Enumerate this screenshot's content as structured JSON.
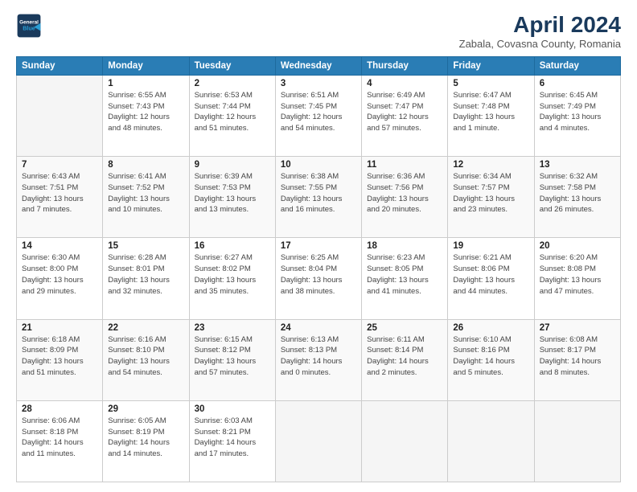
{
  "header": {
    "logo_line1": "General",
    "logo_line2": "Blue",
    "title": "April 2024",
    "subtitle": "Zabala, Covasna County, Romania"
  },
  "weekdays": [
    "Sunday",
    "Monday",
    "Tuesday",
    "Wednesday",
    "Thursday",
    "Friday",
    "Saturday"
  ],
  "weeks": [
    [
      {
        "num": "",
        "info": ""
      },
      {
        "num": "1",
        "info": "Sunrise: 6:55 AM\nSunset: 7:43 PM\nDaylight: 12 hours\nand 48 minutes."
      },
      {
        "num": "2",
        "info": "Sunrise: 6:53 AM\nSunset: 7:44 PM\nDaylight: 12 hours\nand 51 minutes."
      },
      {
        "num": "3",
        "info": "Sunrise: 6:51 AM\nSunset: 7:45 PM\nDaylight: 12 hours\nand 54 minutes."
      },
      {
        "num": "4",
        "info": "Sunrise: 6:49 AM\nSunset: 7:47 PM\nDaylight: 12 hours\nand 57 minutes."
      },
      {
        "num": "5",
        "info": "Sunrise: 6:47 AM\nSunset: 7:48 PM\nDaylight: 13 hours\nand 1 minute."
      },
      {
        "num": "6",
        "info": "Sunrise: 6:45 AM\nSunset: 7:49 PM\nDaylight: 13 hours\nand 4 minutes."
      }
    ],
    [
      {
        "num": "7",
        "info": "Sunrise: 6:43 AM\nSunset: 7:51 PM\nDaylight: 13 hours\nand 7 minutes."
      },
      {
        "num": "8",
        "info": "Sunrise: 6:41 AM\nSunset: 7:52 PM\nDaylight: 13 hours\nand 10 minutes."
      },
      {
        "num": "9",
        "info": "Sunrise: 6:39 AM\nSunset: 7:53 PM\nDaylight: 13 hours\nand 13 minutes."
      },
      {
        "num": "10",
        "info": "Sunrise: 6:38 AM\nSunset: 7:55 PM\nDaylight: 13 hours\nand 16 minutes."
      },
      {
        "num": "11",
        "info": "Sunrise: 6:36 AM\nSunset: 7:56 PM\nDaylight: 13 hours\nand 20 minutes."
      },
      {
        "num": "12",
        "info": "Sunrise: 6:34 AM\nSunset: 7:57 PM\nDaylight: 13 hours\nand 23 minutes."
      },
      {
        "num": "13",
        "info": "Sunrise: 6:32 AM\nSunset: 7:58 PM\nDaylight: 13 hours\nand 26 minutes."
      }
    ],
    [
      {
        "num": "14",
        "info": "Sunrise: 6:30 AM\nSunset: 8:00 PM\nDaylight: 13 hours\nand 29 minutes."
      },
      {
        "num": "15",
        "info": "Sunrise: 6:28 AM\nSunset: 8:01 PM\nDaylight: 13 hours\nand 32 minutes."
      },
      {
        "num": "16",
        "info": "Sunrise: 6:27 AM\nSunset: 8:02 PM\nDaylight: 13 hours\nand 35 minutes."
      },
      {
        "num": "17",
        "info": "Sunrise: 6:25 AM\nSunset: 8:04 PM\nDaylight: 13 hours\nand 38 minutes."
      },
      {
        "num": "18",
        "info": "Sunrise: 6:23 AM\nSunset: 8:05 PM\nDaylight: 13 hours\nand 41 minutes."
      },
      {
        "num": "19",
        "info": "Sunrise: 6:21 AM\nSunset: 8:06 PM\nDaylight: 13 hours\nand 44 minutes."
      },
      {
        "num": "20",
        "info": "Sunrise: 6:20 AM\nSunset: 8:08 PM\nDaylight: 13 hours\nand 47 minutes."
      }
    ],
    [
      {
        "num": "21",
        "info": "Sunrise: 6:18 AM\nSunset: 8:09 PM\nDaylight: 13 hours\nand 51 minutes."
      },
      {
        "num": "22",
        "info": "Sunrise: 6:16 AM\nSunset: 8:10 PM\nDaylight: 13 hours\nand 54 minutes."
      },
      {
        "num": "23",
        "info": "Sunrise: 6:15 AM\nSunset: 8:12 PM\nDaylight: 13 hours\nand 57 minutes."
      },
      {
        "num": "24",
        "info": "Sunrise: 6:13 AM\nSunset: 8:13 PM\nDaylight: 14 hours\nand 0 minutes."
      },
      {
        "num": "25",
        "info": "Sunrise: 6:11 AM\nSunset: 8:14 PM\nDaylight: 14 hours\nand 2 minutes."
      },
      {
        "num": "26",
        "info": "Sunrise: 6:10 AM\nSunset: 8:16 PM\nDaylight: 14 hours\nand 5 minutes."
      },
      {
        "num": "27",
        "info": "Sunrise: 6:08 AM\nSunset: 8:17 PM\nDaylight: 14 hours\nand 8 minutes."
      }
    ],
    [
      {
        "num": "28",
        "info": "Sunrise: 6:06 AM\nSunset: 8:18 PM\nDaylight: 14 hours\nand 11 minutes."
      },
      {
        "num": "29",
        "info": "Sunrise: 6:05 AM\nSunset: 8:19 PM\nDaylight: 14 hours\nand 14 minutes."
      },
      {
        "num": "30",
        "info": "Sunrise: 6:03 AM\nSunset: 8:21 PM\nDaylight: 14 hours\nand 17 minutes."
      },
      {
        "num": "",
        "info": ""
      },
      {
        "num": "",
        "info": ""
      },
      {
        "num": "",
        "info": ""
      },
      {
        "num": "",
        "info": ""
      }
    ]
  ]
}
